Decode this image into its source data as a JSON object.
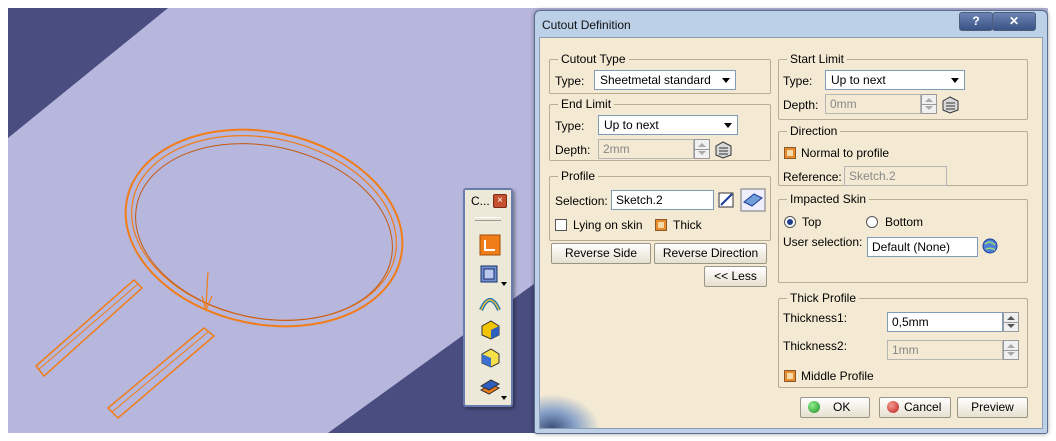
{
  "viewport": {
    "background": "#b7b6dc",
    "stripe_color": "#4a4d80",
    "part_color": "#f07d18"
  },
  "toolbar": {
    "title": "C...",
    "close_label": "×",
    "icons": [
      "flange-icon",
      "cube-tool-icon",
      "bend-icon",
      "solid-cube-icon",
      "yellow-cube-icon",
      "sheet-stack-icon"
    ]
  },
  "dialog": {
    "title": "Cutout Definition",
    "help_label": "?",
    "close_label": "✕",
    "cutout_type": {
      "legend": "Cutout Type",
      "type_label": "Type:",
      "type_value": "Sheetmetal standard"
    },
    "end_limit": {
      "legend": "End Limit",
      "type_label": "Type:",
      "type_value": "Up to next",
      "depth_label": "Depth:",
      "depth_value": "2mm"
    },
    "profile": {
      "legend": "Profile",
      "selection_label": "Selection:",
      "selection_value": "Sketch.2",
      "lying_on_skin_label": "Lying on skin",
      "lying_on_skin_checked": false,
      "thick_label": "Thick",
      "thick_checked": true
    },
    "buttons": {
      "reverse_side": "Reverse Side",
      "reverse_direction": "Reverse Direction",
      "less": "<< Less",
      "ok": "OK",
      "cancel": "Cancel",
      "preview": "Preview"
    },
    "start_limit": {
      "legend": "Start Limit",
      "type_label": "Type:",
      "type_value": "Up to next",
      "depth_label": "Depth:",
      "depth_value": "0mm"
    },
    "direction": {
      "legend": "Direction",
      "normal_label": "Normal to profile",
      "normal_checked": true,
      "reference_label": "Reference:",
      "reference_value": "Sketch.2"
    },
    "impacted_skin": {
      "legend": "Impacted Skin",
      "top_label": "Top",
      "bottom_label": "Bottom",
      "selected": "Top",
      "user_selection_label": "User selection:",
      "user_selection_value": "Default (None)"
    },
    "thick_profile": {
      "legend": "Thick Profile",
      "thickness1_label": "Thickness1:",
      "thickness1_value": "0,5mm",
      "thickness2_label": "Thickness2:",
      "thickness2_value": "1mm",
      "middle_profile_label": "Middle Profile",
      "middle_profile_checked": true
    }
  }
}
